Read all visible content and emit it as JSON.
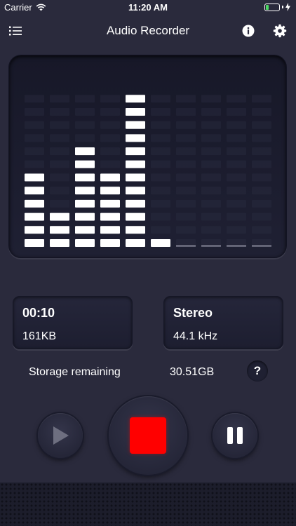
{
  "status_bar": {
    "carrier": "Carrier",
    "time": "11:20 AM",
    "icons": [
      "wifi-icon",
      "battery-icon",
      "charging-bolt-icon"
    ],
    "battery_level": 0.2
  },
  "nav": {
    "title": "Audio Recorder",
    "icons": [
      "recordings-list-icon",
      "info-icon",
      "settings-gear-icon"
    ]
  },
  "visualizer": {
    "columns": 10,
    "max_level": 12,
    "levels": [
      6,
      3,
      8,
      6,
      12,
      1,
      0,
      0,
      0,
      0
    ],
    "active_color": "#ffffff",
    "inactive_color": "#2e3045"
  },
  "recording": {
    "duration": "00:10",
    "size": "161KB",
    "channel": "Stereo",
    "sample_rate": "44.1 kHz"
  },
  "storage": {
    "label": "Storage remaining",
    "value": "30.51GB",
    "help_label": "?"
  },
  "controls": {
    "icons": [
      "play-icon",
      "stop-icon",
      "pause-icon"
    ],
    "stop_color": "#ff0000",
    "play_enabled": false
  }
}
